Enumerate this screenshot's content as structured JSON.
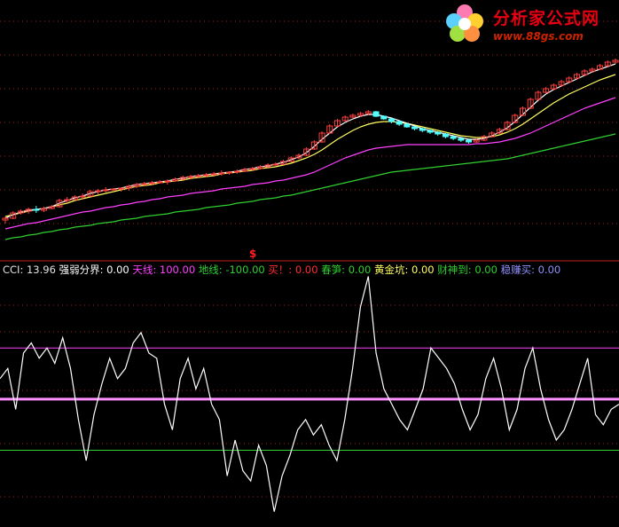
{
  "logo": {
    "text": "分析家公式网",
    "url": "www.88gs.com"
  },
  "signal_mark": "$",
  "legend": [
    {
      "label": "CCI: ",
      "value": "13.96",
      "color": "#e0e0e0"
    },
    {
      "label": "强弱分界: ",
      "value": "0.00",
      "color": "#ffffff"
    },
    {
      "label": "天线: ",
      "value": "100.00",
      "color": "#ff40ff"
    },
    {
      "label": "地线: ",
      "value": "-100.00",
      "color": "#30d030"
    },
    {
      "label": "买！: ",
      "value": "0.00",
      "color": "#ff3030"
    },
    {
      "label": "春笋: ",
      "value": "0.00",
      "color": "#30d030"
    },
    {
      "label": "黄金坑: ",
      "value": "0.00",
      "color": "#ffff60"
    },
    {
      "label": "财神到: ",
      "value": "0.00",
      "color": "#30d030"
    },
    {
      "label": "稳赚买: ",
      "value": "0.00",
      "color": "#9090ff"
    }
  ],
  "colors": {
    "background": "#000000",
    "up_candle": "#ff4040",
    "down_candle": "#50ffff",
    "ma_short": "#ffffff",
    "ma_mid": "#ffff60",
    "ma_long": "#ff40ff",
    "ma_longest": "#30d030",
    "cci_line": "#ffffff",
    "sky_line": "#ff40ff",
    "zero_line": "#ff90ff",
    "ground_line": "#30d030",
    "grid": "#a02020"
  },
  "chart_data": [
    {
      "type": "candlestick",
      "title": "",
      "candles": [
        [
          248,
          246,
          252,
          244
        ],
        [
          246,
          240,
          247,
          238
        ],
        [
          240,
          238,
          242,
          236
        ],
        [
          238,
          236,
          241,
          234
        ],
        [
          236,
          237,
          240,
          232
        ],
        [
          237,
          235,
          239,
          233
        ],
        [
          235,
          233,
          236,
          231
        ],
        [
          233,
          226,
          234,
          224
        ],
        [
          226,
          225,
          229,
          222
        ],
        [
          225,
          222,
          226,
          220
        ],
        [
          222,
          221,
          225,
          218
        ],
        [
          221,
          216,
          222,
          214
        ],
        [
          216,
          215,
          219,
          213
        ],
        [
          215,
          214,
          217,
          211
        ],
        [
          214,
          213,
          216,
          212
        ],
        [
          213,
          212,
          216,
          211
        ],
        [
          212,
          210,
          215,
          208
        ],
        [
          210,
          208,
          212,
          206
        ],
        [
          208,
          207,
          210,
          205
        ],
        [
          207,
          206,
          209,
          204
        ],
        [
          206,
          205,
          207,
          203
        ],
        [
          205,
          204,
          208,
          202
        ],
        [
          204,
          202,
          205,
          200
        ],
        [
          202,
          200,
          203,
          198
        ],
        [
          200,
          199,
          202,
          197
        ],
        [
          199,
          198,
          201,
          196
        ],
        [
          198,
          197,
          200,
          195
        ],
        [
          197,
          196,
          198,
          194
        ],
        [
          196,
          195,
          198,
          192
        ],
        [
          195,
          194,
          197,
          193
        ],
        [
          194,
          193,
          196,
          191
        ],
        [
          193,
          191,
          194,
          189
        ],
        [
          191,
          190,
          193,
          188
        ],
        [
          190,
          188,
          191,
          186
        ],
        [
          188,
          186,
          189,
          184
        ],
        [
          186,
          185,
          187,
          183
        ],
        [
          185,
          182,
          186,
          180
        ],
        [
          182,
          178,
          183,
          176
        ],
        [
          178,
          175,
          179,
          173
        ],
        [
          175,
          168,
          176,
          166
        ],
        [
          168,
          160,
          169,
          158
        ],
        [
          160,
          150,
          161,
          148
        ],
        [
          150,
          142,
          151,
          140
        ],
        [
          142,
          136,
          143,
          134
        ],
        [
          136,
          132,
          137,
          130
        ],
        [
          132,
          130,
          134,
          128
        ],
        [
          130,
          128,
          132,
          126
        ],
        [
          128,
          126,
          130,
          124
        ],
        [
          126,
          131,
          132,
          125
        ],
        [
          131,
          134,
          135,
          130
        ],
        [
          134,
          137,
          139,
          133
        ],
        [
          137,
          140,
          142,
          136
        ],
        [
          140,
          143,
          144,
          139
        ],
        [
          143,
          145,
          147,
          142
        ],
        [
          145,
          147,
          149,
          144
        ],
        [
          147,
          149,
          151,
          146
        ],
        [
          149,
          151,
          153,
          148
        ],
        [
          151,
          154,
          156,
          150
        ],
        [
          154,
          156,
          158,
          153
        ],
        [
          156,
          158,
          160,
          155
        ],
        [
          158,
          160,
          162,
          157
        ],
        [
          160,
          158,
          161,
          156
        ],
        [
          158,
          154,
          159,
          152
        ],
        [
          154,
          150,
          155,
          148
        ],
        [
          150,
          146,
          151,
          144
        ],
        [
          146,
          138,
          147,
          136
        ],
        [
          138,
          130,
          139,
          128
        ],
        [
          130,
          122,
          131,
          120
        ],
        [
          122,
          112,
          123,
          110
        ],
        [
          112,
          104,
          113,
          102
        ],
        [
          104,
          100,
          106,
          98
        ],
        [
          100,
          96,
          102,
          94
        ],
        [
          96,
          92,
          98,
          90
        ],
        [
          92,
          88,
          94,
          86
        ],
        [
          88,
          84,
          90,
          82
        ],
        [
          84,
          80,
          86,
          78
        ],
        [
          80,
          78,
          82,
          76
        ],
        [
          78,
          74,
          79,
          72
        ],
        [
          74,
          70,
          76,
          68
        ],
        [
          70,
          68,
          72,
          66
        ]
      ],
      "ma_short": [
        246,
        242,
        239,
        237,
        236,
        235,
        233,
        229,
        226,
        223,
        221,
        218,
        216,
        214,
        213,
        212,
        210,
        208,
        207,
        206,
        205,
        204,
        202,
        201,
        199,
        198,
        197,
        196,
        195,
        194,
        193,
        191,
        190,
        188,
        187,
        185,
        183,
        180,
        177,
        172,
        165,
        157,
        150,
        143,
        138,
        134,
        131,
        129,
        129,
        131,
        133,
        136,
        139,
        142,
        145,
        147,
        149,
        151,
        153,
        155,
        157,
        157,
        156,
        153,
        149,
        144,
        137,
        129,
        121,
        113,
        106,
        101,
        97,
        93,
        89,
        85,
        81,
        78,
        75,
        72
      ],
      "ma_mid": [
        244,
        242,
        240,
        238,
        236,
        235,
        233,
        231,
        229,
        226,
        224,
        222,
        220,
        218,
        216,
        214,
        212,
        210,
        209,
        208,
        206,
        205,
        204,
        203,
        201,
        200,
        199,
        198,
        196,
        195,
        194,
        193,
        192,
        190,
        189,
        188,
        186,
        184,
        181,
        178,
        174,
        169,
        163,
        157,
        152,
        147,
        143,
        140,
        138,
        137,
        137,
        138,
        139,
        141,
        143,
        145,
        147,
        149,
        151,
        153,
        154,
        155,
        155,
        154,
        152,
        149,
        145,
        140,
        134,
        128,
        122,
        116,
        111,
        106,
        102,
        98,
        94,
        90,
        87,
        84
      ],
      "ma_long": [
        258,
        256,
        254,
        252,
        251,
        249,
        247,
        245,
        243,
        241,
        239,
        238,
        236,
        234,
        233,
        231,
        230,
        228,
        227,
        225,
        224,
        222,
        221,
        220,
        218,
        217,
        216,
        215,
        213,
        212,
        211,
        210,
        208,
        207,
        206,
        204,
        203,
        201,
        199,
        197,
        194,
        190,
        186,
        182,
        178,
        175,
        172,
        169,
        167,
        166,
        165,
        164,
        163,
        163,
        163,
        163,
        163,
        163,
        163,
        163,
        163,
        162,
        162,
        161,
        160,
        158,
        156,
        153,
        150,
        146,
        142,
        138,
        134,
        130,
        126,
        122,
        119,
        116,
        113,
        110
      ],
      "ma_longest": [
        270,
        268,
        267,
        265,
        264,
        262,
        261,
        259,
        258,
        256,
        255,
        254,
        252,
        251,
        250,
        248,
        247,
        246,
        244,
        243,
        242,
        241,
        239,
        238,
        237,
        236,
        234,
        233,
        232,
        231,
        229,
        228,
        227,
        225,
        224,
        223,
        221,
        220,
        218,
        216,
        214,
        212,
        210,
        208,
        206,
        204,
        202,
        200,
        198,
        196,
        194,
        193,
        192,
        191,
        190,
        189,
        188,
        187,
        186,
        185,
        184,
        183,
        182,
        181,
        180,
        179,
        177,
        175,
        173,
        171,
        169,
        167,
        165,
        163,
        161,
        159,
        157,
        155,
        153,
        151
      ]
    },
    {
      "type": "line",
      "title": "CCI",
      "series": [
        {
          "name": "CCI",
          "values": [
            40,
            60,
            -20,
            90,
            110,
            80,
            100,
            70,
            120,
            60,
            -40,
            -120,
            -30,
            30,
            80,
            40,
            60,
            110,
            130,
            90,
            80,
            -10,
            -60,
            40,
            80,
            20,
            60,
            -10,
            -40,
            -150,
            -80,
            -140,
            -160,
            -90,
            -130,
            -220,
            -150,
            -110,
            -60,
            -40,
            -70,
            -50,
            -90,
            -120,
            -40,
            60,
            180,
            240,
            90,
            20,
            -10,
            -40,
            -60,
            -20,
            20,
            100,
            80,
            60,
            30,
            -20,
            -60,
            -30,
            40,
            80,
            20,
            -60,
            -20,
            60,
            100,
            20,
            -40,
            -80,
            -60,
            -20,
            30,
            80,
            -30,
            -50,
            -20,
            -10
          ]
        },
        {
          "name": "天线",
          "values": []
        },
        {
          "name": "强弱分界",
          "values": []
        },
        {
          "name": "地线",
          "values": []
        }
      ]
    }
  ]
}
